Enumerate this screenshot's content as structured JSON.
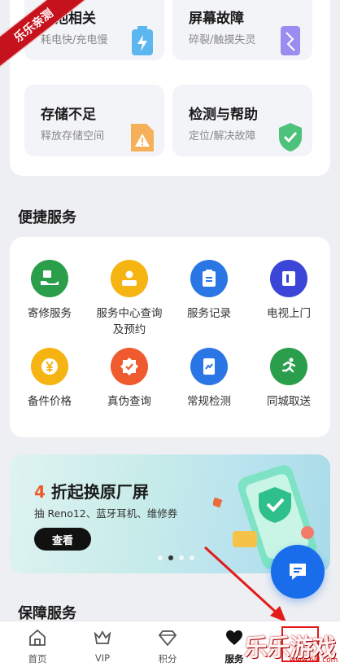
{
  "issues": [
    {
      "title": "电池相关",
      "subtitle": "耗电快/充电慢"
    },
    {
      "title": "屏幕故障",
      "subtitle": "碎裂/触摸失灵"
    },
    {
      "title": "存储不足",
      "subtitle": "释放存储空间"
    },
    {
      "title": "检测与帮助",
      "subtitle": "定位/解决故障"
    }
  ],
  "quick_services": {
    "title": "便捷服务",
    "items": [
      {
        "label": "寄修服务",
        "icon": "mail-repair-icon",
        "color": "#2b9e4b"
      },
      {
        "label": "服务中心查询\n及预约",
        "icon": "service-center-icon",
        "color": "#f5b412"
      },
      {
        "label": "服务记录",
        "icon": "clipboard-icon",
        "color": "#2b76e5"
      },
      {
        "label": "电视上门",
        "icon": "tv-door-icon",
        "color": "#3b46d8"
      },
      {
        "label": "备件价格",
        "icon": "yuan-price-icon",
        "color": "#f5b412"
      },
      {
        "label": "真伪查询",
        "icon": "authenticity-check-icon",
        "color": "#ef5a2f"
      },
      {
        "label": "常规检测",
        "icon": "detection-icon",
        "color": "#2b76e5"
      },
      {
        "label": "同城取送",
        "icon": "courier-run-icon",
        "color": "#2b9e4b"
      }
    ]
  },
  "banner": {
    "headline_num": "4",
    "headline_rest": " 折起换原厂屏",
    "subtitle": "抽 Reno12、蓝牙耳机、维修券",
    "button": "查看",
    "active_dot": 1
  },
  "protection": {
    "title": "保障服务"
  },
  "nav": [
    {
      "label": "首页",
      "icon": "home-icon"
    },
    {
      "label": "VIP",
      "icon": "crown-icon"
    },
    {
      "label": "积分",
      "icon": "diamond-icon"
    },
    {
      "label": "服务",
      "icon": "heart-icon",
      "active": true
    }
  ],
  "watermark": {
    "ribbon": "乐乐亲测",
    "brand": "乐乐游戏",
    "url": "www.6lll.com"
  },
  "colors": {
    "accent": "#1a6dea",
    "highlight": "#f05a28",
    "annotation": "#e31b1b"
  }
}
